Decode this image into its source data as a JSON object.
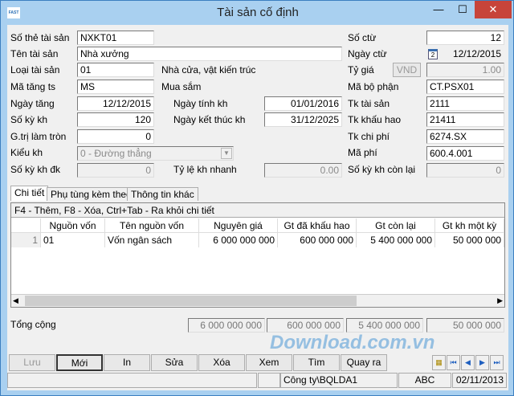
{
  "window": {
    "title": "Tài sản cố định",
    "logo": "FAST"
  },
  "form": {
    "so_the": {
      "label": "Số thẻ tài sản",
      "value": "NXKT01"
    },
    "ten": {
      "label": "Tên tài sản",
      "value": "Nhà xưởng"
    },
    "loai": {
      "label": "Loại tài sản",
      "value": "01",
      "desc": "Nhà cửa, vật kiến trúc"
    },
    "ma_tang": {
      "label": "Mã tăng ts",
      "value": "MS",
      "desc": "Mua sắm"
    },
    "ngay_tang": {
      "label": "Ngày tăng",
      "value": "12/12/2015"
    },
    "so_ky": {
      "label": "Số kỳ kh",
      "value": "120"
    },
    "gtri_lam_tron": {
      "label": "G.trị làm tròn",
      "value": "0"
    },
    "kieu_kh": {
      "label": "Kiểu kh",
      "value": "0 - Đường thẳng"
    },
    "so_ky_dk": {
      "label": "Số kỳ kh đk",
      "value": "0"
    },
    "ngay_tinh": {
      "label": "Ngày tính kh",
      "value": "01/01/2016"
    },
    "ngay_kt": {
      "label": "Ngày kết thúc kh",
      "value": "31/12/2025"
    },
    "ty_le": {
      "label": "Tỷ lệ kh nhanh",
      "value": "0.00"
    },
    "so_ctu": {
      "label": "Số ctừ",
      "value": "12"
    },
    "ngay_ctu": {
      "label": "Ngày ctừ",
      "value": "12/12/2015",
      "calendar_day": "2"
    },
    "ty_gia": {
      "label": "Tỷ giá",
      "currency": "VND",
      "value": "1.00"
    },
    "ma_bo_phan": {
      "label": "Mã bộ phận",
      "value": "CT.PSX01"
    },
    "tk_ts": {
      "label": "Tk tài sản",
      "value": "2111"
    },
    "tk_kh": {
      "label": "Tk khấu hao",
      "value": "21411"
    },
    "tk_cp": {
      "label": "Tk chi phí",
      "value": "6274.SX"
    },
    "ma_phi": {
      "label": "Mã phí",
      "value": "600.4.001"
    },
    "so_ky_con": {
      "label": "Số kỳ kh còn lại",
      "value": "0"
    }
  },
  "tabs": [
    "Chi tiết",
    "Phụ tùng kèm theo",
    "Thông tin khác"
  ],
  "grid": {
    "hint": "F4 - Thêm, F8 - Xóa, Ctrl+Tab - Ra khỏi chi tiết",
    "columns": [
      "Nguồn vốn",
      "Tên nguồn vốn",
      "Nguyên giá",
      "Gt đã khấu hao",
      "Gt còn lại",
      "Gt kh một kỳ"
    ],
    "rows": [
      {
        "no": "1",
        "cells": [
          "01",
          "Vốn ngân sách",
          "6 000 000 000",
          "600 000 000",
          "5 400 000 000",
          "50 000 000"
        ]
      }
    ]
  },
  "totals": {
    "label": "Tổng cộng",
    "values": [
      "6 000 000 000",
      "600 000 000",
      "5 400 000 000",
      "50 000 000"
    ]
  },
  "buttons": [
    "Lưu",
    "Mới",
    "In",
    "Sửa",
    "Xóa",
    "Xem",
    "Tìm",
    "Quay ra"
  ],
  "watermark": "Download.com.vn",
  "status": {
    "company": "Công ty\\BQLDA1",
    "lang": "ABC",
    "date": "02/11/2013"
  }
}
